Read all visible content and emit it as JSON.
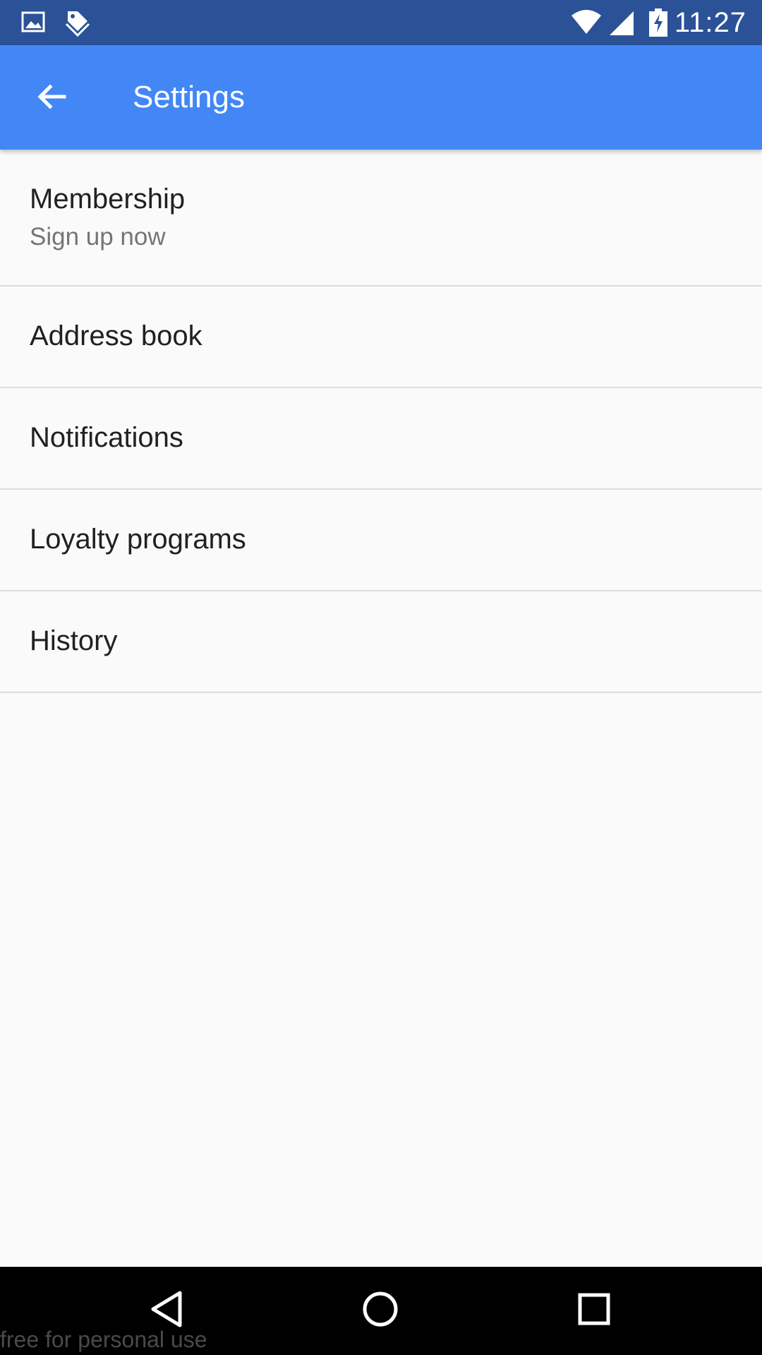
{
  "status_bar": {
    "time": "11:27",
    "icons": [
      "image-icon",
      "tag-icon",
      "wifi-icon",
      "cell-signal-icon",
      "battery-charging-icon"
    ]
  },
  "app_bar": {
    "title": "Settings",
    "back_icon": "arrow-back-icon"
  },
  "settings": {
    "items": [
      {
        "title": "Membership",
        "subtitle": "Sign up now"
      },
      {
        "title": "Address book"
      },
      {
        "title": "Notifications"
      },
      {
        "title": "Loyalty programs"
      },
      {
        "title": "History"
      }
    ]
  },
  "nav_bar": {
    "buttons": [
      "back-triangle-icon",
      "home-circle-icon",
      "recents-square-icon"
    ]
  },
  "watermark": "free for personal use",
  "colors": {
    "status_bar": "#2b5297",
    "app_bar": "#4287f5",
    "background": "#fafafa",
    "divider": "#dcdcdc"
  }
}
